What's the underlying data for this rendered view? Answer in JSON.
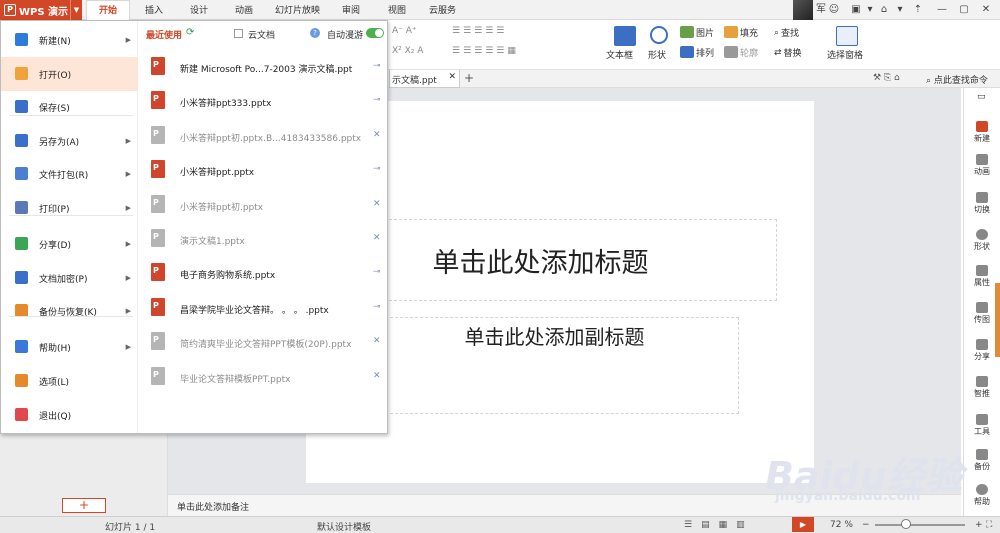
{
  "app": {
    "name": "WPS 演示"
  },
  "ribbon_tabs": [
    "开始",
    "插入",
    "设计",
    "动画",
    "幻灯片放映",
    "审阅",
    "视图",
    "云服务"
  ],
  "active_tab": "开始",
  "topbar_user": "军",
  "ribbon": {
    "textbox": "文本框",
    "shape": "形状",
    "picture": "图片",
    "fill": "填充",
    "arrange": "排列",
    "outline": "轮廓",
    "find": "查找",
    "replace": "替换",
    "select_pane": "选择窗格",
    "search_cmd": "点此查找命令"
  },
  "document_tab": {
    "title": "示文稿.ppt"
  },
  "file_menu": {
    "items": [
      {
        "label": "新建(N)",
        "icon": "new-doc-icon",
        "color": "#2f7bd9"
      },
      {
        "label": "打开(O)",
        "icon": "open-folder-icon",
        "color": "#f0a23b"
      },
      {
        "label": "保存(S)",
        "icon": "save-icon",
        "color": "#3b6fc9"
      },
      {
        "label": "另存为(A)",
        "icon": "save-as-icon",
        "color": "#3b6fc9"
      },
      {
        "label": "文件打包(R)",
        "icon": "package-icon",
        "color": "#4a7fd1"
      },
      {
        "label": "打印(P)",
        "icon": "printer-icon",
        "color": "#5b79b8"
      },
      {
        "label": "分享(D)",
        "icon": "share-icon",
        "color": "#3aa655"
      },
      {
        "label": "文档加密(P)",
        "icon": "lock-icon",
        "color": "#3b6fc9"
      },
      {
        "label": "备份与恢复(K)",
        "icon": "backup-icon",
        "color": "#e58a2a"
      },
      {
        "label": "帮助(H)",
        "icon": "help-icon",
        "color": "#3b78d8"
      },
      {
        "label": "选项(L)",
        "icon": "gear-icon",
        "color": "#e58a2a"
      },
      {
        "label": "退出(Q)",
        "icon": "exit-icon",
        "color": "#e0484a"
      }
    ],
    "recent_header": "最近使用",
    "cloud_label": "云文档",
    "auto_roam_label": "自动漫游",
    "recent_files": [
      {
        "name": "新建 Microsoft Po...7-2003 演示文稿.ppt",
        "available": true
      },
      {
        "name": "小米答辩ppt333.pptx",
        "available": true
      },
      {
        "name": "小米答辩ppt初.pptx.B...4183433586.pptx",
        "available": false
      },
      {
        "name": "小米答辩ppt.pptx",
        "available": true
      },
      {
        "name": "小米答辩ppt初.pptx",
        "available": false
      },
      {
        "name": "演示文稿1.pptx",
        "available": false
      },
      {
        "name": "电子商务购物系统.pptx",
        "available": true
      },
      {
        "name": "昌梁学院毕业论文答辩。 。 。 .pptx",
        "available": true
      },
      {
        "name": "简约清爽毕业论文答辩PPT模板(20P).pptx",
        "available": false
      },
      {
        "name": "毕业论文答辩模板PPT.pptx",
        "available": false
      }
    ]
  },
  "slide": {
    "title_placeholder": "单击此处添加标题",
    "subtitle_placeholder": "单击此处添加副标题"
  },
  "notes_placeholder": "单击此处添加备注",
  "right_panel": [
    "新建",
    "动画",
    "切换",
    "形状",
    "属性",
    "传图",
    "分享",
    "智推",
    "工具",
    "备份",
    "帮助"
  ],
  "status": {
    "slide_counter": "幻灯片 1 / 1",
    "template": "默认设计模板",
    "zoom": "72 %"
  },
  "watermark": {
    "brand": "Baidu经验",
    "url": "jingyan.baidu.com"
  },
  "colors": {
    "accent": "#d24726",
    "toggle_on": "#4caf50",
    "ppt_icon": "#d0452b"
  }
}
